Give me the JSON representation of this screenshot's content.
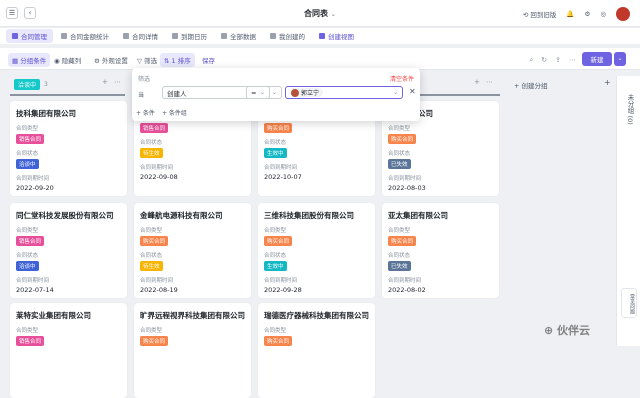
{
  "app": {
    "title": "合同表",
    "title_caret": "⌄"
  },
  "topbar": {
    "back_icon": "chevron-left-icon",
    "return_label": "回到旧版"
  },
  "tabs": [
    {
      "label": "合同管理",
      "active": true
    },
    {
      "label": "合同金额统计"
    },
    {
      "label": "合同详情"
    },
    {
      "label": "到期日历"
    },
    {
      "label": "全部数据"
    },
    {
      "label": "我创建的"
    },
    {
      "label": "创建视图",
      "create": true
    }
  ],
  "toolbar": {
    "group_label": "分组条件",
    "hide_label": "隐藏列",
    "view_label": "外观设置",
    "filter_label": "筛选",
    "sort_label": "1 排序",
    "save_label": "保存",
    "create_label": "新建",
    "create_dd": "⌄"
  },
  "column": {
    "group_name": "洽谈中",
    "group_count": "3",
    "add_group": "+ 创建分组"
  },
  "side_panel": {
    "label": "未分组 (0)",
    "plus": "+"
  },
  "help": {
    "label": "常见问题"
  },
  "watermark": "伙伴云",
  "filter": {
    "title": "筛选",
    "clear": "清空条件",
    "when": "当",
    "field": "创建人",
    "operator": "=",
    "value": "郭立宁",
    "add_condition": "+ 条件",
    "add_group": "+ 条件组",
    "close": "✕"
  },
  "card_labels": {
    "type": "合同类型",
    "status": "合同状态",
    "due": "合同到期时间"
  },
  "cards": [
    {
      "company": "技科集团有限公司",
      "type": "销售合同",
      "type_color": "#e84f9b",
      "status": "洽谈中",
      "status_color": "#3f63d6",
      "date": "2022-09-20"
    },
    {
      "company": "",
      "type": "销售合同",
      "type_color": "#e84f9b",
      "status": "待生效",
      "status_color": "#f7b500",
      "date": "2022-09-08"
    },
    {
      "company": "",
      "type": "购买合同",
      "type_color": "#f7844a",
      "status": "生效中",
      "status_color": "#14b8c4",
      "date": "2022-10-07"
    },
    {
      "company": "集团有限公司",
      "type": "购买合同",
      "type_color": "#f7844a",
      "status": "已失效",
      "status_color": "#5b7599",
      "date": "2022-08-03"
    },
    {
      "company": "同仁堂科技发展股份有限公司",
      "type": "销售合同",
      "type_color": "#e84f9b",
      "status": "洽谈中",
      "status_color": "#3f63d6",
      "date": "2022-07-14"
    },
    {
      "company": "金峰航电源科技有限公司",
      "type": "购买合同",
      "type_color": "#f7844a",
      "status": "待生效",
      "status_color": "#f7b500",
      "date": "2022-08-19"
    },
    {
      "company": "三维科技集团股份有限公司",
      "type": "购买合同",
      "type_color": "#f7844a",
      "status": "生效中",
      "status_color": "#14b8c4",
      "date": "2022-09-28"
    },
    {
      "company": "亚太集团有限公司",
      "type": "购买合同",
      "type_color": "#f7844a",
      "status": "已失效",
      "status_color": "#5b7599",
      "date": "2022-08-02"
    },
    {
      "company": "莱特实业集团有限公司",
      "type": "销售合同",
      "type_color": "#e84f9b",
      "status": "",
      "status_color": "",
      "date": ""
    },
    {
      "company": "旷界远程视界科技集团有限公司",
      "type": "购买合同",
      "type_color": "#f7844a",
      "status": "",
      "status_color": "",
      "date": ""
    },
    {
      "company": "瑞德医疗器械科技集团有限公司",
      "type": "购买合同",
      "type_color": "#f7844a",
      "status": "",
      "status_color": "",
      "date": ""
    }
  ]
}
